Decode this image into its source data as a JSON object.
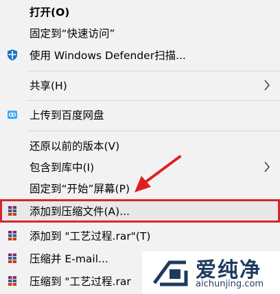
{
  "menu": {
    "items": [
      {
        "label": "打开(O)"
      },
      {
        "label": "固定到“快速访问”"
      },
      {
        "label": "使用 Windows Defender扫描...",
        "icon": "windows-defender-icon"
      },
      {
        "label": "共享(H)"
      },
      {
        "label": "上传到百度网盘",
        "icon": "baidu-netdisk-icon"
      },
      {
        "label": "还原以前的版本(V)"
      },
      {
        "label": "包含到库中(I)"
      },
      {
        "label": "固定到“开始”屏幕(P)"
      },
      {
        "label": "添加到压缩文件(A)...",
        "icon": "winrar-icon",
        "highlighted": true
      },
      {
        "label": "添加到 \"工艺过程.rar\"(T)",
        "icon": "winrar-icon"
      },
      {
        "label": "压缩并 E-mail...",
        "icon": "winrar-icon"
      },
      {
        "label": "压缩到 \"工艺过程.rar",
        "icon": "winrar-icon"
      }
    ]
  },
  "watermark": {
    "name": "爱纯净",
    "url": "aichunjing.com"
  },
  "colors": {
    "highlight_border": "#d7262e",
    "arrow": "#e02020",
    "defender_blue": "#1c6fc4",
    "watermark": "#1e3a5f"
  }
}
